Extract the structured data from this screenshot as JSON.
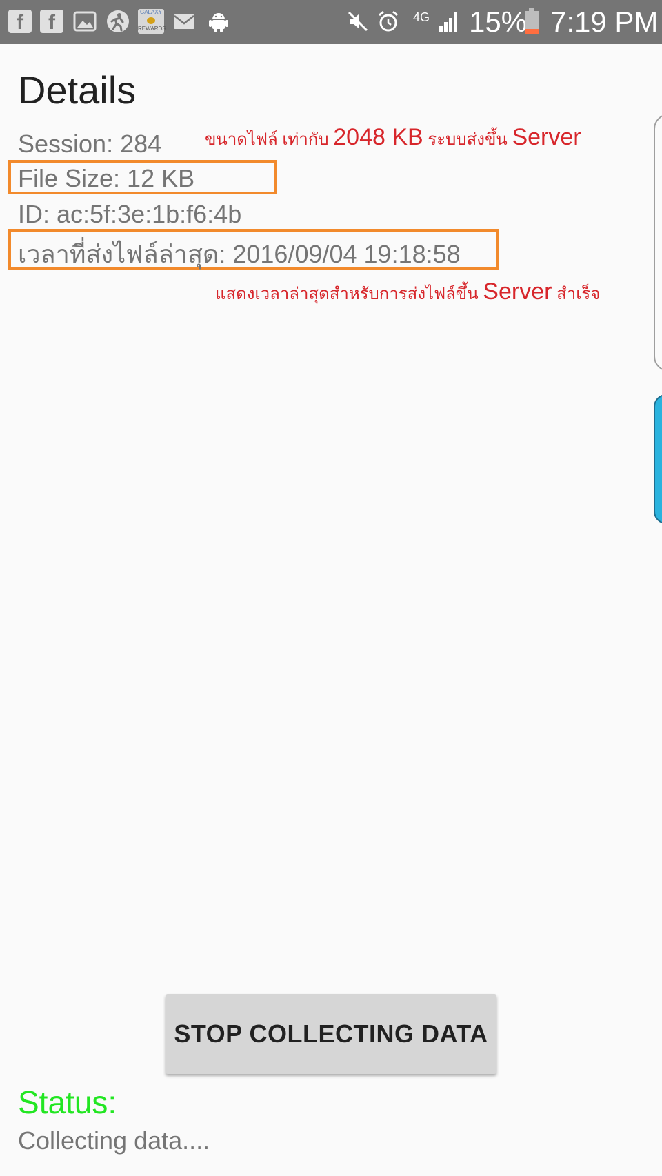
{
  "status_bar": {
    "notification_icons": [
      "facebook-icon",
      "facebook-icon",
      "gallery-icon",
      "running-app-icon",
      "galaxy-rewards-icon",
      "mail-icon",
      "android-icon"
    ],
    "galaxy_rewards_top": "GALAXY",
    "galaxy_rewards_bottom": "REWARDS",
    "network": "4G",
    "battery": "15%",
    "time": "7:19 PM"
  },
  "details": {
    "title": "Details",
    "session": "Session: 284",
    "file_size": "File Size: 12 KB",
    "device_id": "ID: ac:5f:3e:1b:f6:4b",
    "last_sent": "เวลาที่ส่งไฟล์ล่าสุด: 2016/09/04 19:18:58"
  },
  "annotations": {
    "file_size_note": {
      "part1": "ขนาดไฟล์ เท่ากับ ",
      "part2": "2048 KB",
      "part3": " ระบบส่งขึ้น ",
      "part4": "Server"
    },
    "last_sent_note": {
      "part1": "แสดงเวลาล่าสุดสำหรับการส่งไฟล์ขึ้น ",
      "part2": "Server",
      "part3": " สำเร็จ"
    }
  },
  "actions": {
    "stop_button": "STOP COLLECTING DATA"
  },
  "status": {
    "label": "Status:",
    "value": "Collecting data...."
  },
  "colors": {
    "status_bar": "#757575",
    "highlight_box": "#f28a2c",
    "annotation_text": "#d7262b",
    "status_label": "#22e622",
    "side_card_blue": "#2ab3de"
  }
}
